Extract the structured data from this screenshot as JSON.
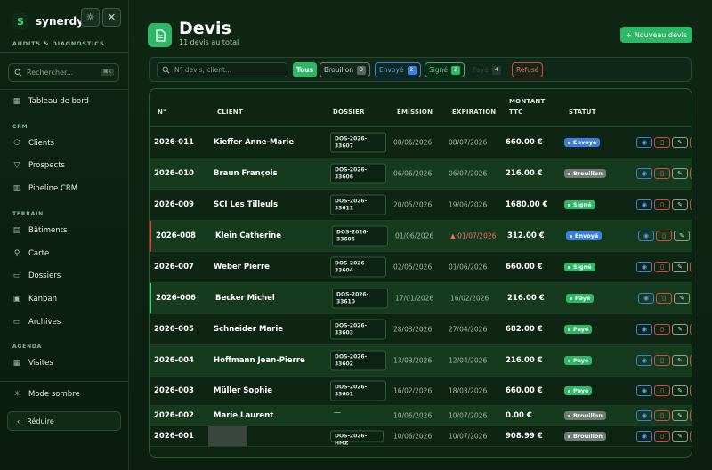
{
  "brand": {
    "name": "synerdys",
    "subtitle": "AUDITS & DIAGNOSTICS",
    "logo": "S"
  },
  "topbar_icons": {
    "theme": "sun-icon",
    "close": "close-icon"
  },
  "sidebar": {
    "search_placeholder": "Rechercher...",
    "search_kbd": "⌘K",
    "top_item": {
      "label": "Tableau de bord",
      "icon": "dashboard-icon"
    },
    "sections": [
      {
        "title": "CRM",
        "items": [
          {
            "label": "Clients",
            "icon": "users-icon"
          },
          {
            "label": "Prospects",
            "icon": "filter-icon"
          },
          {
            "label": "Pipeline CRM",
            "icon": "pipeline-icon"
          }
        ]
      },
      {
        "title": "TERRAIN",
        "items": [
          {
            "label": "Bâtiments",
            "icon": "building-icon"
          },
          {
            "label": "Carte",
            "icon": "map-pin-icon"
          },
          {
            "label": "Dossiers",
            "icon": "folder-icon"
          },
          {
            "label": "Kanban",
            "icon": "kanban-icon"
          },
          {
            "label": "Archives",
            "icon": "archive-icon"
          }
        ]
      },
      {
        "title": "AGENDA",
        "items": [
          {
            "label": "Visites",
            "icon": "calendar-icon"
          }
        ]
      }
    ],
    "dark_mode": "Mode sombre",
    "collapse": "Réduire"
  },
  "header": {
    "title": "Devis",
    "subtitle": "11 devis au total",
    "new_button": "Nouveau devis"
  },
  "filters": {
    "search_placeholder": "N° devis, client...",
    "chips": [
      {
        "label": "Tous",
        "count": ""
      },
      {
        "label": "Brouillon",
        "count": "3"
      },
      {
        "label": "Envoyé",
        "count": "2"
      },
      {
        "label": "Signé",
        "count": "2"
      },
      {
        "label": "Payé",
        "count": "4"
      },
      {
        "label": "Refusé",
        "count": ""
      }
    ]
  },
  "table": {
    "columns": [
      "N°",
      "CLIENT",
      "DOSSIER",
      "ÉMISSION",
      "EXPIRATION",
      "MONTANT",
      "TTC",
      "STATUT"
    ],
    "rows": [
      {
        "num": "2026-011",
        "client": "Kieffer Anne-Marie",
        "dossier1": "DOS-2026-",
        "dossier2": "33607",
        "emission": "08/06/2026",
        "expiration": "08/07/2026",
        "amount": "660.00 €",
        "status": "Envoyé"
      },
      {
        "num": "2026-010",
        "client": "Braun François",
        "dossier1": "DOS-2026-",
        "dossier2": "33606",
        "emission": "06/06/2026",
        "expiration": "06/07/2026",
        "amount": "216.00 €",
        "status": "Brouillon"
      },
      {
        "num": "2026-009",
        "client": "SCI Les Tilleuls",
        "dossier1": "DOS-2026-",
        "dossier2": "33611",
        "emission": "20/05/2026",
        "expiration": "19/06/2026",
        "amount": "1680.00 €",
        "status": "Signé"
      },
      {
        "num": "2026-008",
        "client": "Klein Catherine",
        "dossier1": "DOS-2026-",
        "dossier2": "33605",
        "emission": "01/06/2026",
        "expiration": "01/07/2026",
        "amount": "312.00 €",
        "status": "Envoyé"
      },
      {
        "num": "2026-007",
        "client": "Weber Pierre",
        "dossier1": "DOS-2026-",
        "dossier2": "33604",
        "emission": "02/05/2026",
        "expiration": "01/06/2026",
        "amount": "660.00 €",
        "status": "Signé"
      },
      {
        "num": "2026-006",
        "client": "Becker Michel",
        "dossier1": "DOS-2026-",
        "dossier2": "33610",
        "emission": "17/01/2026",
        "expiration": "16/02/2026",
        "amount": "216.00 €",
        "status": "Payé"
      },
      {
        "num": "2026-005",
        "client": "Schneider Marie",
        "dossier1": "DOS-2026-",
        "dossier2": "33603",
        "emission": "28/03/2026",
        "expiration": "27/04/2026",
        "amount": "682.00 €",
        "status": "Payé"
      },
      {
        "num": "2026-004",
        "client": "Hoffmann Jean-Pierre",
        "dossier1": "DOS-2026-",
        "dossier2": "33602",
        "emission": "13/03/2026",
        "expiration": "12/04/2026",
        "amount": "216.00 €",
        "status": "Payé"
      },
      {
        "num": "2026-003",
        "client": "Müller Sophie",
        "dossier1": "DOS-2026-",
        "dossier2": "33601",
        "emission": "16/02/2026",
        "expiration": "18/03/2026",
        "amount": "660.00 €",
        "status": "Payé"
      },
      {
        "num": "2026-002",
        "client": "Marie Laurent",
        "dossier1": "—",
        "dossier2": "",
        "emission": "10/06/2026",
        "expiration": "10/07/2026",
        "amount": "0.00 €",
        "status": "Brouillon"
      },
      {
        "num": "2026-001",
        "client": "",
        "dossier1": "DOS-2026-HMZ",
        "dossier2": "",
        "emission": "10/06/2026",
        "expiration": "10/07/2026",
        "amount": "908.99 €",
        "status": "Brouillon"
      }
    ]
  },
  "colors": {
    "accent": "#2fb768",
    "envoye": "#3b7fe0",
    "brouillon": "#6f7d74",
    "signe": "#2fb768",
    "paye": "#2fb768",
    "refuse": "#d9483a",
    "overdue": "#ff6b5b"
  }
}
